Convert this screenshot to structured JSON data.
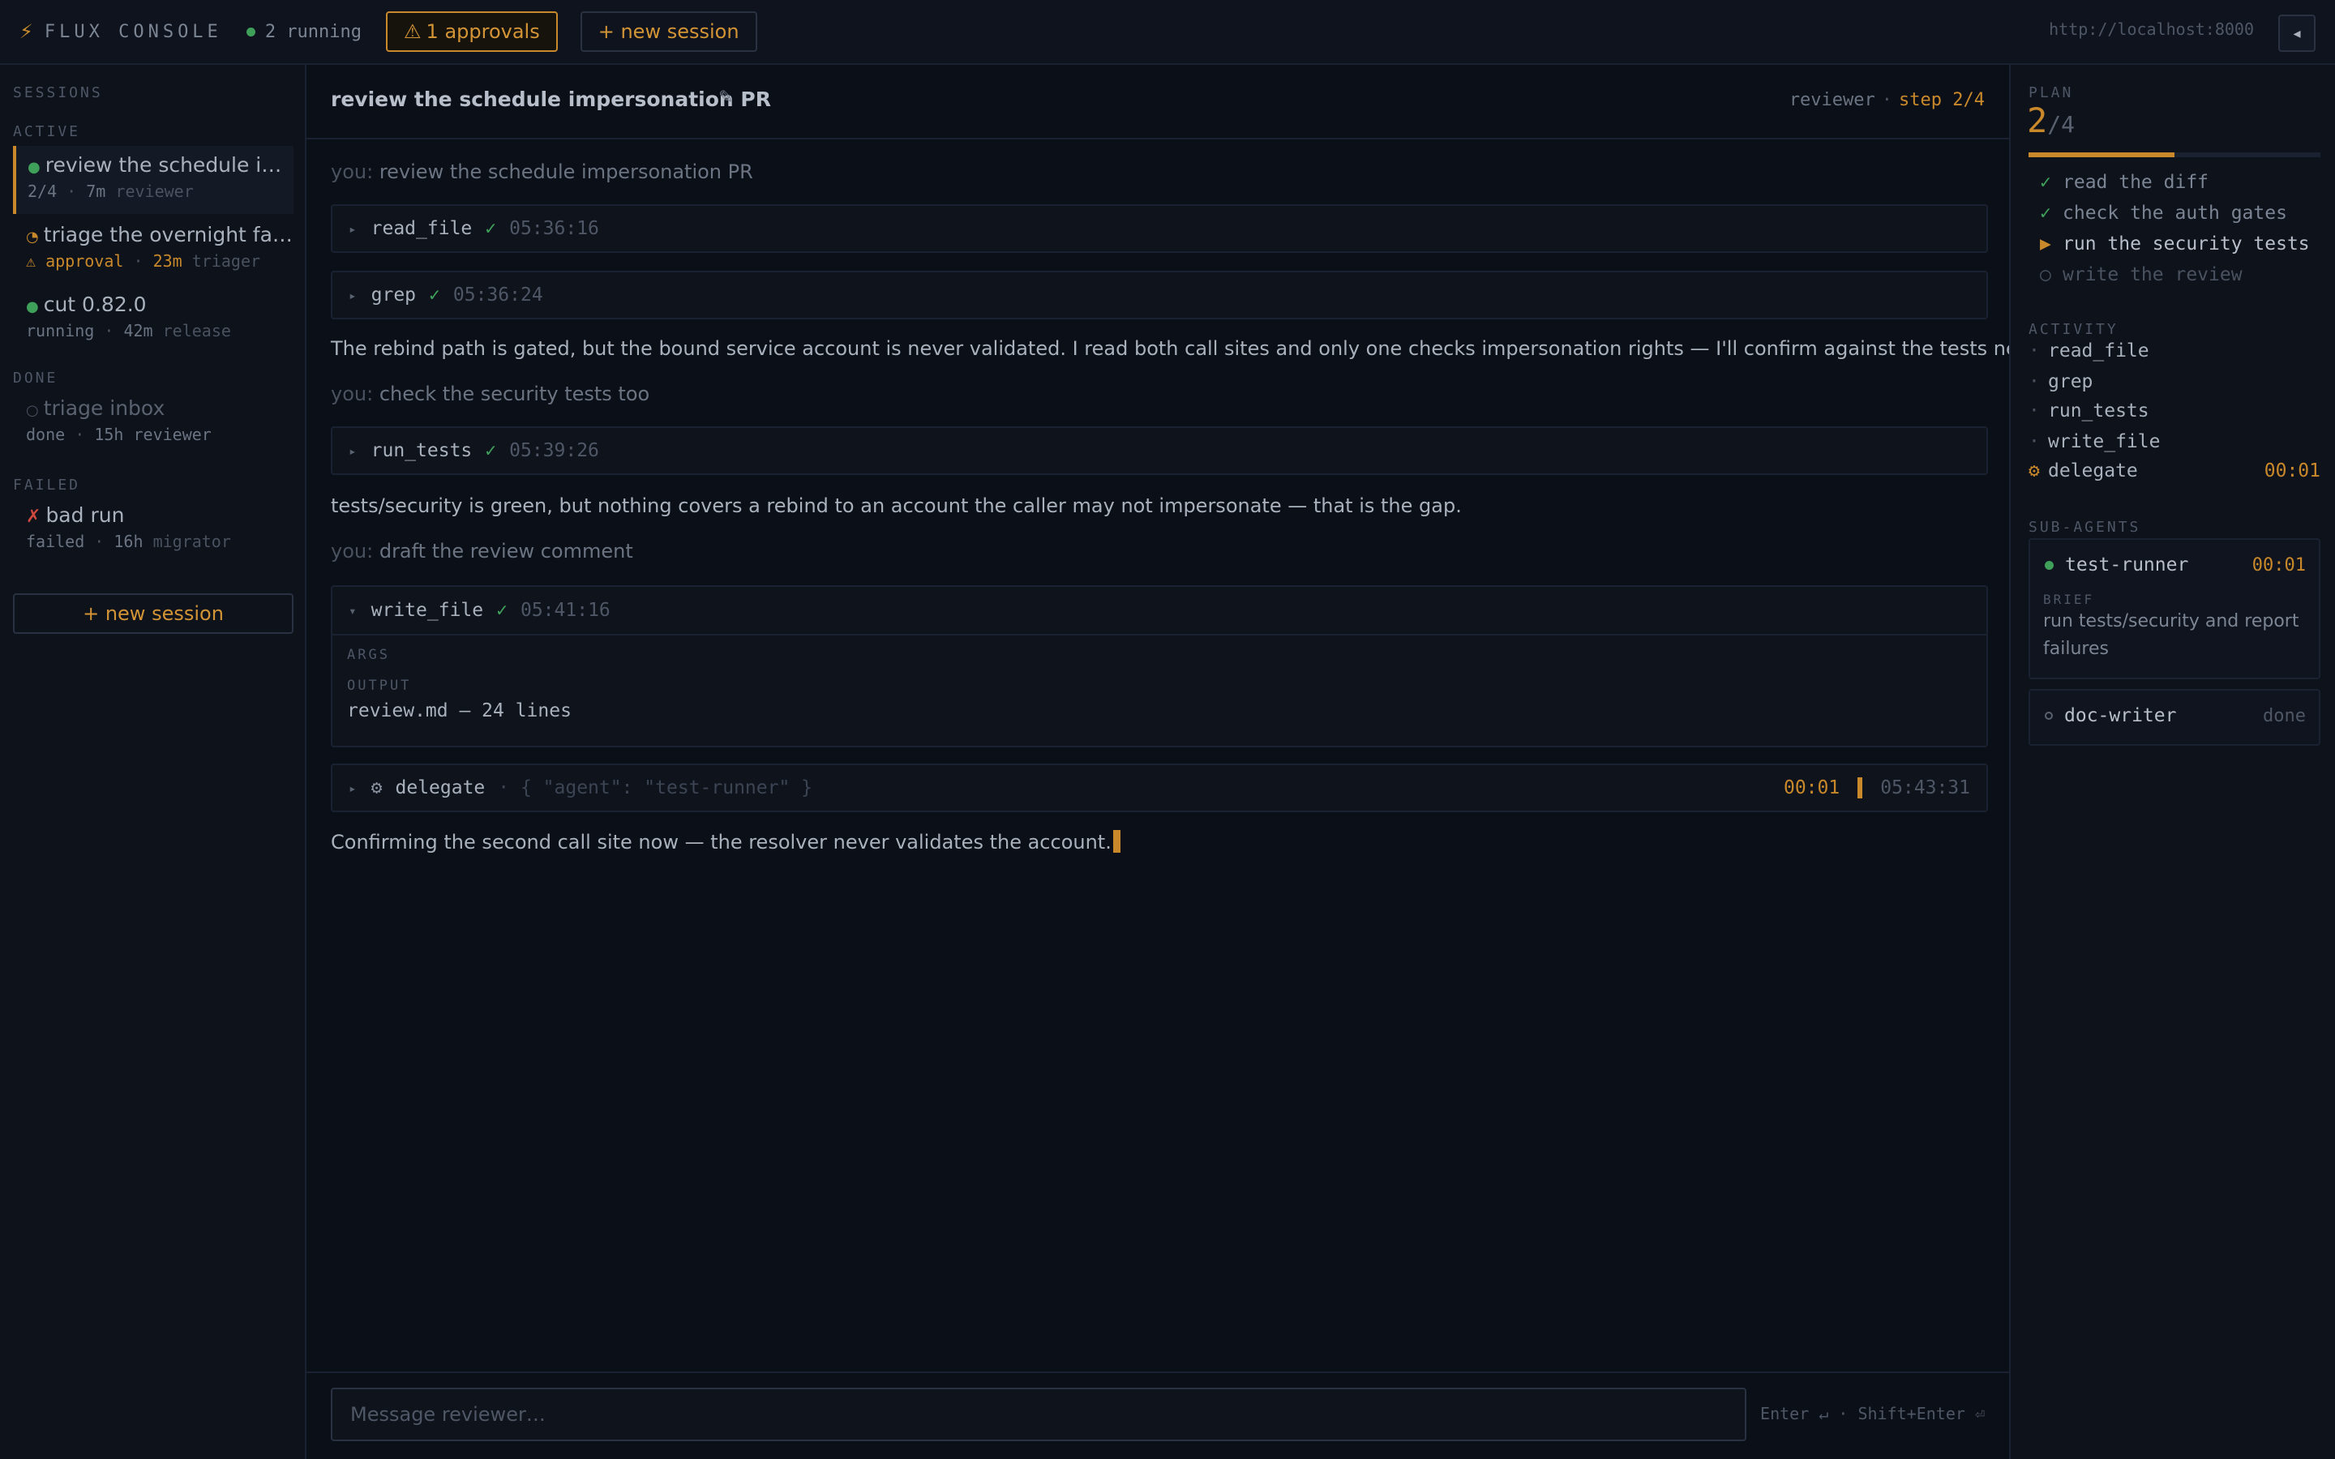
{
  "topbar": {
    "brand_icon": "bolt-icon",
    "brand": "FLUX CONSOLE",
    "running": "2 running",
    "approvals": "1 approvals",
    "new_session": "+ new session",
    "server_url": "http://localhost:8000",
    "collapse_icon": "chevron-left-icon"
  },
  "sidebar": {
    "sessions_label": "SESSIONS",
    "active_label": "ACTIVE",
    "done_label": "DONE",
    "failed_label": "FAILED",
    "active": [
      {
        "title": "review the schedule impersonation PR",
        "status": "2/4",
        "age": "7m",
        "agent": "reviewer"
      },
      {
        "title": "triage the overnight failures",
        "status": "approval",
        "age": "23m",
        "agent": "triager"
      },
      {
        "title": "cut 0.82.0",
        "status": "running",
        "age": "42m",
        "agent": "release"
      }
    ],
    "done": [
      {
        "title": "triage inbox",
        "status": "done",
        "age": "15h",
        "agent": "reviewer"
      }
    ],
    "failed": [
      {
        "title": "bad run",
        "status": "failed",
        "age": "16h",
        "agent": "migrator"
      }
    ],
    "new_session": "+ new session"
  },
  "main": {
    "title": "review the schedule impersonation PR",
    "agent": "reviewer",
    "step": "step 2/4",
    "you_prefix": "you:",
    "transcript": {
      "u1": "review the schedule impersonation PR",
      "t1": {
        "name": "read_file",
        "time": "05:36:16"
      },
      "t2": {
        "name": "grep",
        "time": "05:36:24"
      },
      "a1": "The rebind path is gated, but the bound service account is never validated. I read both call sites and only one checks impersonation rights — I'll confirm against the tests next.",
      "u2": "check the security tests too",
      "t3": {
        "name": "run_tests",
        "time": "05:39:26"
      },
      "a2": "tests/security is green, but nothing covers a rebind to an account the caller may not impersonate — that is the gap.",
      "u3": "draft the review comment",
      "t4": {
        "name": "write_file",
        "time": "05:41:16",
        "args_label": "ARGS",
        "output_label": "OUTPUT",
        "output": "review.md — 24 lines"
      },
      "t5": {
        "name": "delegate",
        "args": "· { \"agent\": \"test-runner\" }",
        "elapsed": "00:01",
        "time": "05:43:31"
      },
      "a3": "Confirming the second call site now — the resolver never validates the account."
    },
    "composer_placeholder": "Message reviewer…",
    "hint": "Enter ↵ · Shift+Enter ⏎"
  },
  "right": {
    "plan_label": "PLAN",
    "plan_current": "2",
    "plan_total": "/4",
    "plan_progress": 0.5,
    "plan": [
      {
        "label": "read the diff",
        "state": "done"
      },
      {
        "label": "check the auth gates",
        "state": "done"
      },
      {
        "label": "run the security tests",
        "state": "current"
      },
      {
        "label": "write the review",
        "state": "todo"
      }
    ],
    "activity_label": "ACTIVITY",
    "activity": [
      {
        "label": "read_file"
      },
      {
        "label": "grep"
      },
      {
        "label": "run_tests"
      },
      {
        "label": "write_file"
      },
      {
        "label": "delegate",
        "elapsed": "00:01"
      }
    ],
    "subagents_label": "SUB-AGENTS",
    "subagents": [
      {
        "name": "test-runner",
        "elapsed": "00:01",
        "brief_label": "BRIEF",
        "brief": "run tests/security and report failures"
      },
      {
        "name": "doc-writer",
        "status": "done"
      }
    ]
  },
  "colors": {
    "accent": "#c9892b",
    "ok": "#3fa05a",
    "error": "#d0493f",
    "bg": "#0b0f17"
  }
}
